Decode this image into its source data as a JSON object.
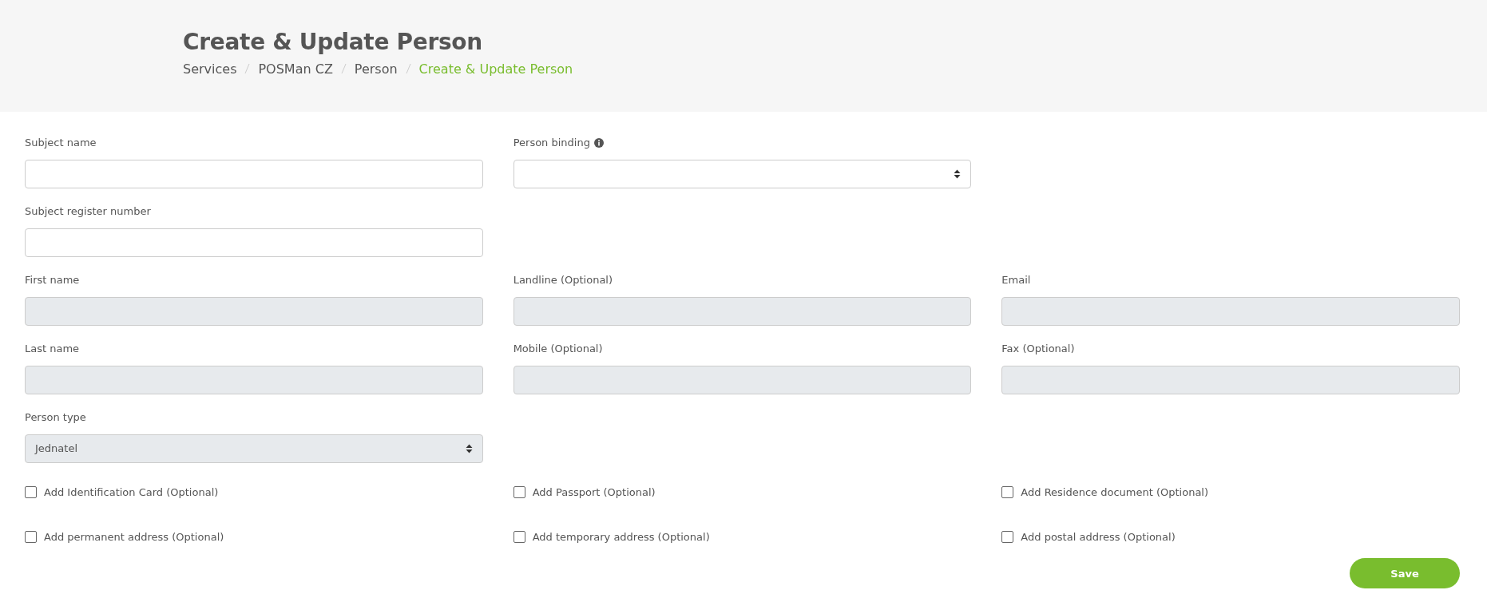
{
  "header": {
    "title": "Create & Update Person",
    "breadcrumb": [
      {
        "label": "Services",
        "current": false
      },
      {
        "label": "POSMan CZ",
        "current": false
      },
      {
        "label": "Person",
        "current": false
      },
      {
        "label": "Create & Update Person",
        "current": true
      }
    ]
  },
  "sections": [
    {
      "columns": [
        [
          {
            "label": "Subject name",
            "kind": "text",
            "disabled": false
          },
          {
            "label": "Subject register number",
            "kind": "text",
            "disabled": false
          }
        ],
        [
          {
            "label": "Person binding",
            "kind": "select",
            "disabled": false,
            "info": true
          }
        ]
      ]
    },
    {
      "columns": [
        [
          {
            "label": "First name",
            "kind": "text",
            "disabled": true
          },
          {
            "label": "Last name",
            "kind": "text",
            "disabled": true
          },
          {
            "label": "Person type",
            "kind": "select",
            "disabled": true,
            "value": "Jednatel"
          }
        ],
        [
          {
            "label": "Landline (Optional)",
            "kind": "text",
            "disabled": true
          },
          {
            "label": "Mobile (Optional)",
            "kind": "text",
            "disabled": true
          }
        ],
        [
          {
            "label": "Email",
            "kind": "text",
            "disabled": true
          },
          {
            "label": "Fax (Optional)",
            "kind": "text",
            "disabled": true
          }
        ]
      ]
    }
  ],
  "checkboxes": [
    {
      "label": "Add Identification Card (Optional)",
      "checked": false
    },
    {
      "label": "Add Passport (Optional)",
      "checked": false
    },
    {
      "label": "Add Residence document (Optional)",
      "checked": false
    },
    {
      "label": "Add permanent address (Optional)",
      "checked": false
    },
    {
      "label": "Add temporary address (Optional)",
      "checked": false
    },
    {
      "label": "Add postal address (Optional)",
      "checked": false
    }
  ],
  "save_button": "Save"
}
